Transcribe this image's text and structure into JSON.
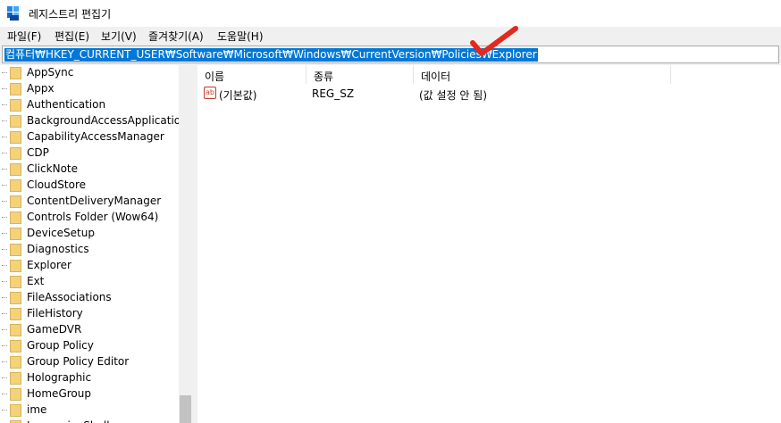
{
  "window": {
    "title": "레지스트리 편집기"
  },
  "menu": [
    "파일(F)",
    "편집(E)",
    "보기(V)",
    "즐겨찾기(A)",
    "도움말(H)"
  ],
  "address": {
    "path": "컴퓨터₩HKEY_CURRENT_USER₩Software₩Microsoft₩Windows₩CurrentVersion₩Policies₩Explorer"
  },
  "annotation": {
    "checkmark_color": "#e3281d"
  },
  "tree": {
    "items": [
      "AppSync",
      "Appx",
      "Authentication",
      "BackgroundAccessApplications",
      "CapabilityAccessManager",
      "CDP",
      "ClickNote",
      "CloudStore",
      "ContentDeliveryManager",
      "Controls Folder (Wow64)",
      "DeviceSetup",
      "Diagnostics",
      "Explorer",
      "Ext",
      "FileAssociations",
      "FileHistory",
      "GameDVR",
      "Group Policy",
      "Group Policy Editor",
      "Holographic",
      "HomeGroup",
      "ime",
      "ImmersiveShell"
    ]
  },
  "values": {
    "headers": {
      "name": "이름",
      "type": "종류",
      "data": "데이터"
    },
    "rows": [
      {
        "icon": "string-value-icon",
        "name": "(기본값)",
        "type": "REG_SZ",
        "data": "(값 설정 안 됨)"
      }
    ]
  },
  "colors": {
    "selection": "#0078d7",
    "folder": "#f3d27a"
  }
}
